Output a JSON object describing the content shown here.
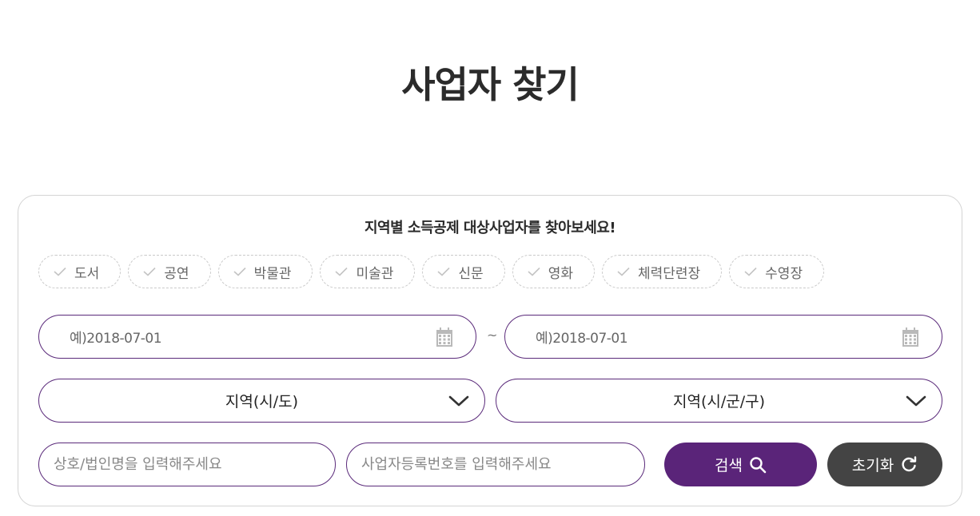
{
  "page": {
    "title": "사업자 찾기"
  },
  "panel": {
    "heading": "지역별 소득공제 대상사업자를 찾아보세요!",
    "categories": [
      "도서",
      "공연",
      "박물관",
      "미술관",
      "신문",
      "영화",
      "체력단련장",
      "수영장"
    ],
    "date_range": {
      "start_placeholder": "예)2018-07-01",
      "end_placeholder": "예)2018-07-01",
      "separator": "~"
    },
    "region": {
      "province_label": "지역(시/도)",
      "district_label": "지역(시/군/구)"
    },
    "search": {
      "name_placeholder": "상호/법인명을 입력해주세요",
      "biznum_placeholder": "사업자등록번호를 입력해주세요",
      "search_label": "검색",
      "reset_label": "초기화"
    }
  },
  "colors": {
    "accent": "#5a2479",
    "reset": "#444444",
    "border": "#5a2a7a"
  },
  "icons": [
    "check-icon",
    "calendar-icon",
    "chevron-down-icon",
    "search-icon",
    "refresh-icon"
  ]
}
